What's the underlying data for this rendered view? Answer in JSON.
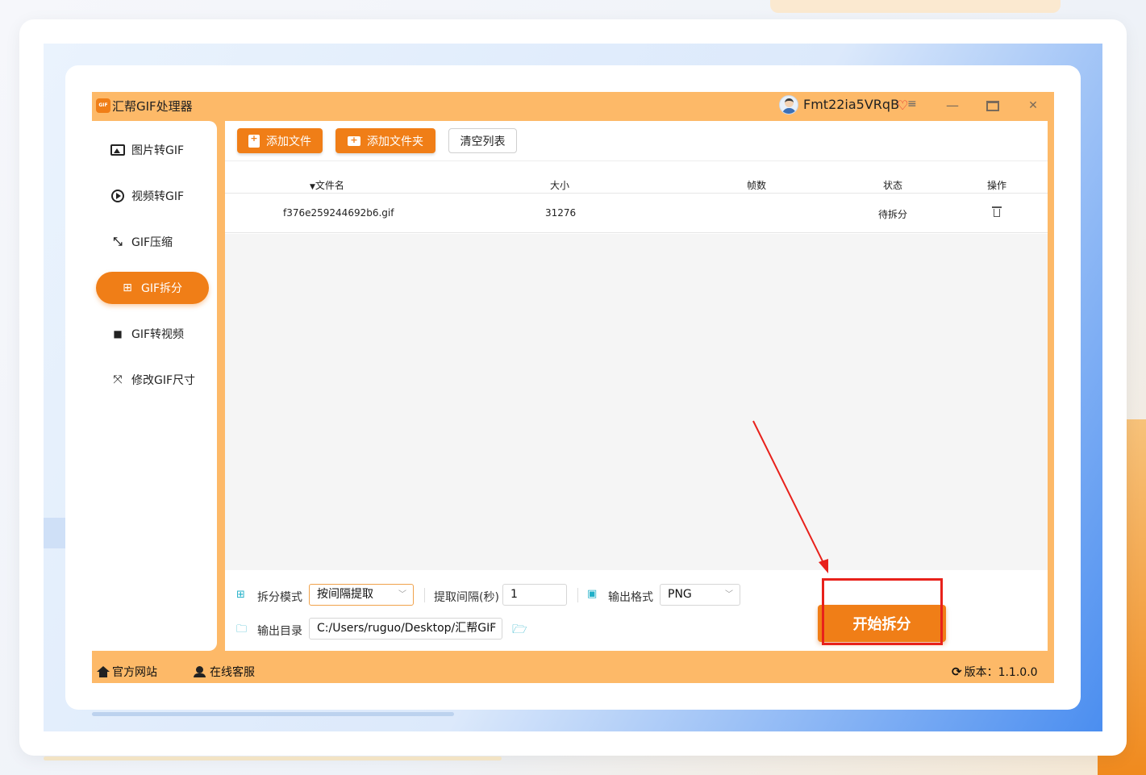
{
  "app": {
    "title": "汇帮GIF处理器",
    "logo_text": "GIF",
    "username": "Fmt22ia5VRqB",
    "accent_color": "#f07e17",
    "window_bg": "#fdb968"
  },
  "sidebar": {
    "items": [
      {
        "label": "图片转GIF",
        "icon": "image-icon"
      },
      {
        "label": "视频转GIF",
        "icon": "play-icon"
      },
      {
        "label": "GIF压缩",
        "icon": "compress-icon"
      },
      {
        "label": "GIF拆分",
        "icon": "grid-icon",
        "active": true
      },
      {
        "label": "GIF转视频",
        "icon": "video-icon"
      },
      {
        "label": "修改GIF尺寸",
        "icon": "resize-icon"
      }
    ]
  },
  "toolbar": {
    "add_file": "添加文件",
    "add_folder": "添加文件夹",
    "clear_list": "清空列表"
  },
  "table": {
    "headers": [
      "文件名",
      "大小",
      "帧数",
      "状态",
      "操作"
    ],
    "rows": [
      {
        "name": "f376e259244692b6.gif",
        "size": "31276",
        "frames": "",
        "status": "待拆分"
      }
    ]
  },
  "options": {
    "split_mode_label": "拆分模式",
    "split_mode_value": "按间隔提取",
    "interval_label": "提取间隔(秒)",
    "interval_value": "1",
    "format_label": "输出格式",
    "format_value": "PNG",
    "output_dir_label": "输出目录",
    "output_dir_value": "C:/Users/ruguo/Desktop/汇帮GIF"
  },
  "start_button": "开始拆分",
  "statusbar": {
    "website": "官方网站",
    "support": "在线客服",
    "version": "版本：1.1.0.0"
  }
}
